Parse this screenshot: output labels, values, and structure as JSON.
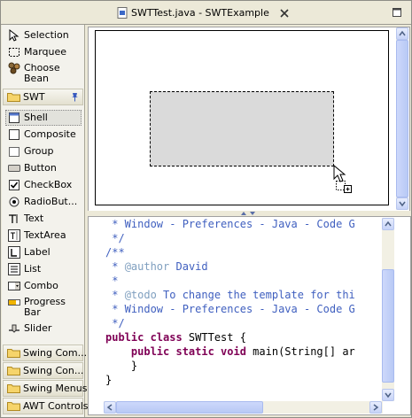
{
  "window": {
    "title": "SWTTest.java - SWTExample",
    "close_icon": "close-x-icon"
  },
  "palette": {
    "tools": [
      {
        "label": "Selection",
        "icon": "arrow-cursor-icon"
      },
      {
        "label": "Marquee",
        "icon": "marquee-icon"
      },
      {
        "label": "Choose Bean",
        "icon": "choose-bean-icon"
      }
    ],
    "swt_drawer": {
      "label": "SWT",
      "icon": "folder-icon",
      "pin_icon": "pin-icon"
    },
    "swt_items": [
      {
        "label": "Shell",
        "icon": "shell-icon"
      },
      {
        "label": "Composite",
        "icon": "composite-icon"
      },
      {
        "label": "Group",
        "icon": "group-icon"
      },
      {
        "label": "Button",
        "icon": "button-icon"
      },
      {
        "label": "CheckBox",
        "icon": "checkbox-icon"
      },
      {
        "label": "RadioBut...",
        "icon": "radio-icon"
      },
      {
        "label": "Text",
        "icon": "text-icon"
      },
      {
        "label": "TextArea",
        "icon": "textarea-icon"
      },
      {
        "label": "Label",
        "icon": "label-icon"
      },
      {
        "label": "List",
        "icon": "list-icon"
      },
      {
        "label": "Combo",
        "icon": "combo-icon"
      },
      {
        "label": "Progress Bar",
        "icon": "progress-bar-icon"
      },
      {
        "label": "Slider",
        "icon": "slider-icon"
      }
    ],
    "drawers": [
      {
        "label": "Swing Com..."
      },
      {
        "label": "Swing Con..."
      },
      {
        "label": "Swing Menus"
      },
      {
        "label": "AWT Controls"
      }
    ]
  },
  "editor": {
    "lines": [
      {
        "text": " * Window - Preferences - Java - Code G",
        "style": "cm"
      },
      {
        "text": " */",
        "style": "cm"
      },
      {
        "text": "/**",
        "style": "cm"
      },
      {
        "text": " * ",
        "style": "cm",
        "tag": "@author",
        "rest": " David"
      },
      {
        "text": " *",
        "style": "cm"
      },
      {
        "text": " * ",
        "style": "cm",
        "tag": "@todo",
        "rest": " To change the template for thi"
      },
      {
        "text": " * Window - Preferences - Java - Code G",
        "style": "cm"
      },
      {
        "text": " */",
        "style": "cm"
      },
      {
        "kw": "public class",
        "rest": " SWTTest {"
      },
      {
        "indent": "    ",
        "kw": "public static void",
        "rest": " main(String[] ar"
      },
      {
        "text": "    }",
        "style": "plain"
      },
      {
        "text": "}",
        "style": "plain"
      }
    ]
  },
  "colors": {
    "comment": "#3f5fbf",
    "keyword": "#7f0055",
    "javadoc_tag": "#7f9fbf",
    "scrollbar": "#c6d3f7"
  }
}
